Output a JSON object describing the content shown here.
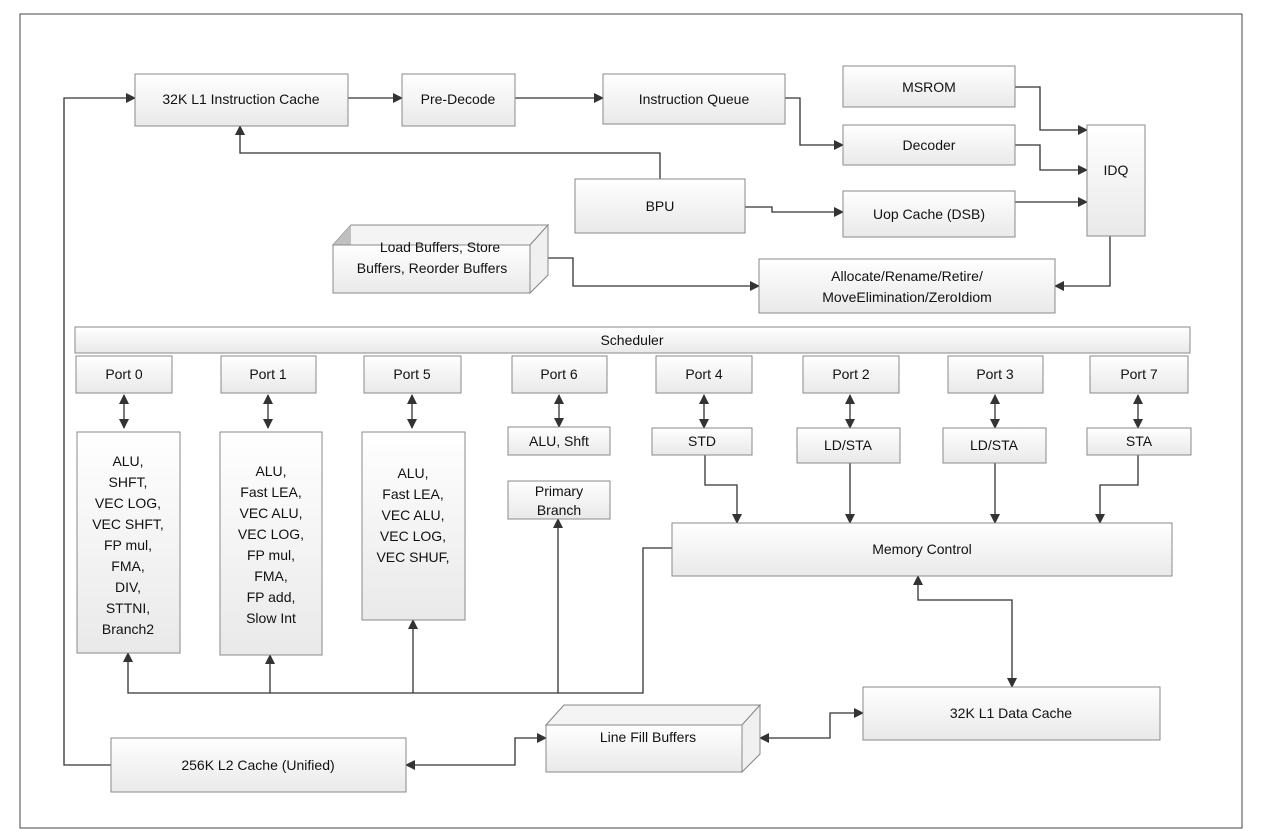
{
  "blocks": {
    "l1i": "32K L1 Instruction Cache",
    "predecode": "Pre-Decode",
    "iq": "Instruction Queue",
    "msrom": "MSROM",
    "decoder": "Decoder",
    "idq": "IDQ",
    "bpu": "BPU",
    "uop": "Uop Cache (DSB)",
    "buffers": [
      "Load Buffers, Store",
      "Buffers, Reorder Buffers"
    ],
    "allocate": [
      "Allocate/Rename/Retire/",
      "MoveElimination/ZeroIdiom"
    ],
    "scheduler": "Scheduler",
    "memctrl": "Memory Control",
    "l1d": "32K L1 Data Cache",
    "lfb": "Line Fill Buffers",
    "l2": "256K L2 Cache (Unified)"
  },
  "ports": [
    "Port 0",
    "Port 1",
    "Port 5",
    "Port 6",
    "Port 4",
    "Port 2",
    "Port 3",
    "Port 7"
  ],
  "units": {
    "p0": [
      "ALU,",
      "SHFT,",
      "VEC LOG,",
      "VEC SHFT,",
      "FP mul,",
      "FMA,",
      "DIV,",
      "STTNI,",
      "Branch2"
    ],
    "p1": [
      "ALU,",
      "Fast LEA,",
      "VEC ALU,",
      "VEC LOG,",
      "FP mul,",
      "FMA,",
      "FP add,",
      "Slow Int"
    ],
    "p5": [
      "ALU,",
      "Fast LEA,",
      "VEC ALU,",
      "VEC LOG,",
      "VEC SHUF,"
    ],
    "p6a": "ALU, Shft",
    "p6b": [
      "Primary",
      "Branch"
    ],
    "p4": "STD",
    "p2": "LD/STA",
    "p3": "LD/STA",
    "p7": "STA"
  }
}
